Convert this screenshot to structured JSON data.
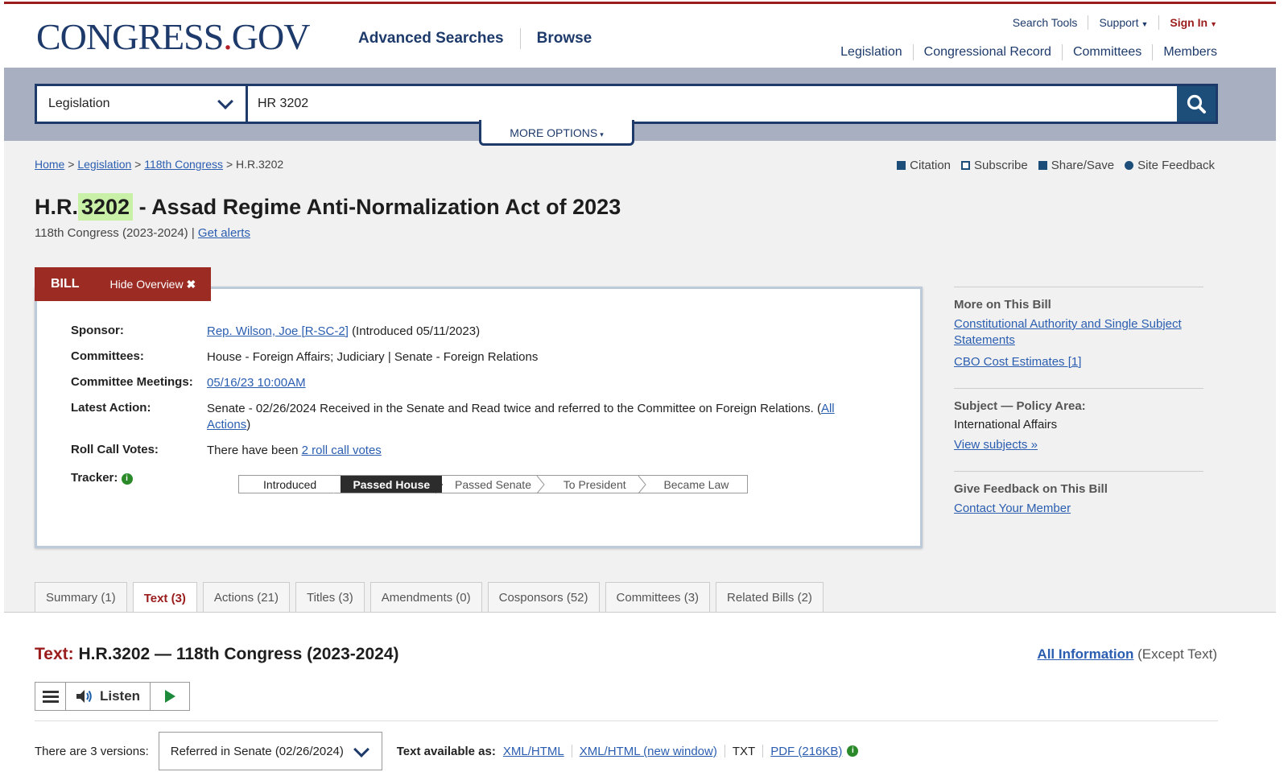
{
  "header": {
    "logo_main": "CONGRESS",
    "logo_dot": ".",
    "logo_suffix": "GOV",
    "main_nav": [
      "Advanced Searches",
      "Browse"
    ],
    "util_nav": [
      "Search Tools",
      "Support",
      "Sign In"
    ],
    "sec_nav": [
      "Legislation",
      "Congressional Record",
      "Committees",
      "Members"
    ]
  },
  "search": {
    "scope": "Legislation",
    "query": "HR 3202",
    "more_options": "MORE OPTIONS"
  },
  "breadcrumb": {
    "items": [
      "Home",
      "Legislation",
      "118th Congress"
    ],
    "current": "H.R.3202",
    "sep": ">"
  },
  "tools": [
    "Citation",
    "Subscribe",
    "Share/Save",
    "Site Feedback"
  ],
  "bill": {
    "prefix": "H.R.",
    "number": "3202",
    "title_rest": "- Assad Regime Anti-Normalization Act of 2023",
    "congress": "118th Congress (2023-2024) |",
    "get_alerts": "Get alerts",
    "tab_label": "BILL",
    "hide_overview": "Hide Overview"
  },
  "overview": {
    "sponsor_label": "Sponsor:",
    "sponsor_link": "Rep. Wilson, Joe [R-SC-2]",
    "sponsor_note": "(Introduced 05/11/2023)",
    "committees_label": "Committees:",
    "committees": "House - Foreign Affairs; Judiciary | Senate - Foreign Relations",
    "meetings_label": "Committee Meetings:",
    "meetings_link": "05/16/23 10:00AM",
    "latest_label": "Latest Action:",
    "latest_text": "Senate - 02/26/2024 Received in the Senate and Read twice and referred to the Committee on Foreign Relations.  (",
    "latest_link": "All Actions",
    "latest_close": ")",
    "rollcall_label": "Roll Call Votes:",
    "rollcall_text": "There have been",
    "rollcall_link": "2 roll call votes",
    "tracker_label": "Tracker:",
    "tracker": [
      "Introduced",
      "Passed House",
      "Passed Senate",
      "To President",
      "Became Law"
    ],
    "tracker_current": "Passed House"
  },
  "sidebar": {
    "more_title": "More on This Bill",
    "more_links": [
      "Constitutional Authority and Single Subject Statements",
      "CBO Cost Estimates [1]"
    ],
    "subject_title": "Subject — Policy Area:",
    "subject_value": "International Affairs",
    "subject_link": "View subjects",
    "feedback_title": "Give Feedback on This Bill",
    "feedback_link": "Contact Your Member"
  },
  "tabs": [
    {
      "label": "Summary (1)"
    },
    {
      "label": "Text (3)",
      "active": true
    },
    {
      "label": "Actions (21)"
    },
    {
      "label": "Titles (3)"
    },
    {
      "label": "Amendments (0)"
    },
    {
      "label": "Cosponsors (52)"
    },
    {
      "label": "Committees (3)"
    },
    {
      "label": "Related Bills (2)"
    }
  ],
  "text_section": {
    "label": "Text:",
    "heading": "H.R.3202 — 118th Congress (2023-2024)",
    "all_info": "All Information",
    "all_info_note": "(Except Text)",
    "listen": "Listen",
    "versions_label": "There are 3 versions:",
    "version_selected": "Referred in Senate (02/26/2024)",
    "formats_label": "Text available as:",
    "formats": [
      "XML/HTML",
      "XML/HTML (new window)",
      "TXT",
      "PDF (216KB)"
    ]
  },
  "colors": {
    "brand_navy": "#1d3a6b",
    "brand_red": "#9b1c1c",
    "highlight": "#c9f0a7",
    "link": "#2a5db0"
  }
}
